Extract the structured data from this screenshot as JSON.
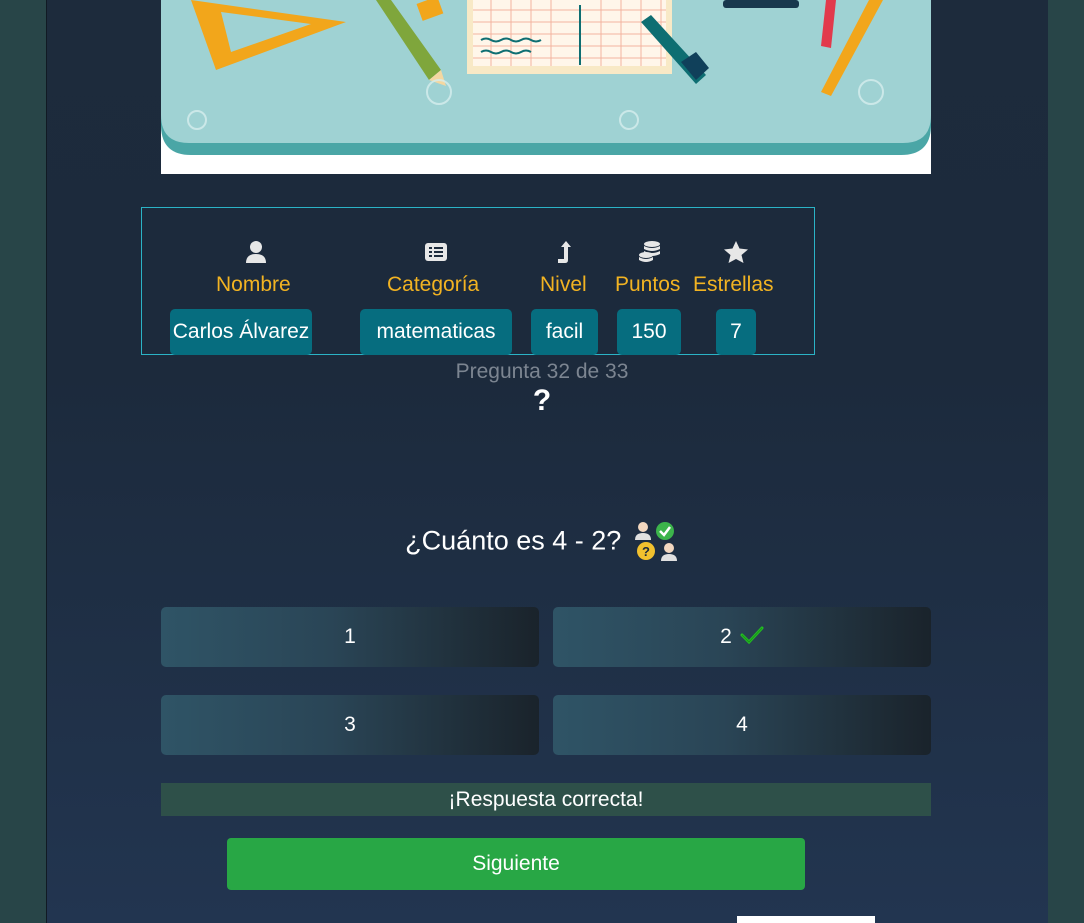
{
  "hero": {
    "alt": "Ilustración de útiles escolares de matemáticas"
  },
  "stats": [
    {
      "icon": "user-icon",
      "label": "Nombre",
      "value": "Carlos Álvarez"
    },
    {
      "icon": "list-icon",
      "label": "Categoría",
      "value": "matematicas"
    },
    {
      "icon": "level-up-icon",
      "label": "Nivel",
      "value": "facil"
    },
    {
      "icon": "coins-icon",
      "label": "Puntos",
      "value": "150"
    },
    {
      "icon": "star-icon",
      "label": "Estrellas",
      "value": "7"
    }
  ],
  "quiz": {
    "progress": "Pregunta 32 de 33",
    "mark": "?",
    "question": "¿Cuánto es 4 - 2?",
    "answers": [
      {
        "text": "1",
        "correct": false
      },
      {
        "text": "2",
        "correct": true
      },
      {
        "text": "3",
        "correct": false
      },
      {
        "text": "4",
        "correct": false
      }
    ],
    "feedback": "¡Respuesta correcta!",
    "next_label": "Siguiente"
  },
  "colors": {
    "accent_label": "#f2b322",
    "value_bg": "#066d7f",
    "next_button": "#28a745",
    "check": "#22c022"
  }
}
